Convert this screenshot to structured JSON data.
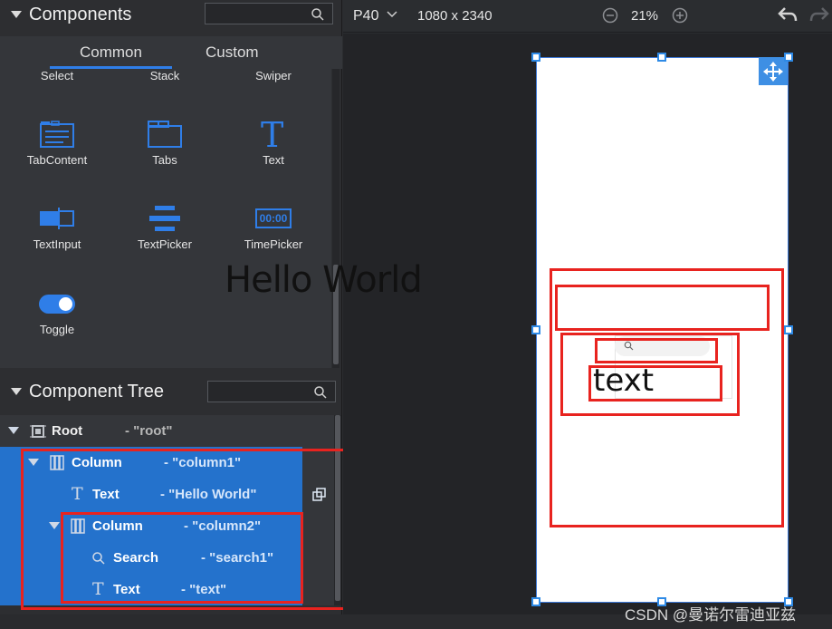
{
  "components_panel": {
    "title": "Components",
    "search_placeholder": ""
  },
  "tabs": [
    {
      "label": "Common"
    },
    {
      "label": "Custom"
    }
  ],
  "palette_partial_labels": [
    "Select",
    "Stack",
    "Swiper"
  ],
  "palette_items": [
    {
      "label": "TabContent",
      "icon": "tab-content-icon"
    },
    {
      "label": "Tabs",
      "icon": "tabs-icon"
    },
    {
      "label": "Text",
      "icon": "text-icon"
    },
    {
      "label": "TextInput",
      "icon": "text-input-icon"
    },
    {
      "label": "TextPicker",
      "icon": "text-picker-icon"
    },
    {
      "label": "TimePicker",
      "icon": "time-picker-icon",
      "icon_text": "00:00"
    },
    {
      "label": "Toggle",
      "icon": "toggle-icon"
    }
  ],
  "component_tree": {
    "title": "Component Tree",
    "rows": [
      {
        "name": "Root",
        "id": "- \"root\""
      },
      {
        "name": "Column",
        "id": "- \"column1\""
      },
      {
        "name": "Text",
        "id": "- \"Hello World\""
      },
      {
        "name": "Column",
        "id": "- \"column2\""
      },
      {
        "name": "Search",
        "id": "- \"search1\""
      },
      {
        "name": "Text",
        "id": "- \"text\""
      }
    ]
  },
  "toolbar": {
    "device": "P40",
    "resolution": "1080 x 2340",
    "zoom": "21%"
  },
  "preview": {
    "hello_text": "Hello World",
    "text_value": "text"
  },
  "watermark": "CSDN @曼诺尔雷迪亚兹",
  "colors": {
    "accent": "#2f7ee8",
    "selection": "#2472cc",
    "highlight": "#e8231f",
    "handle": "#2e8ae6"
  }
}
